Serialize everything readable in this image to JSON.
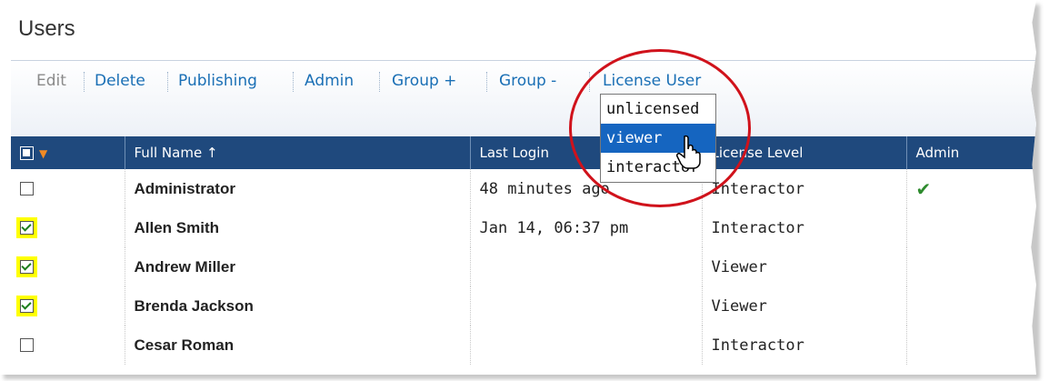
{
  "page": {
    "title": "Users"
  },
  "toolbar": {
    "items": [
      {
        "label": "Edit",
        "enabled": false
      },
      {
        "label": "Delete",
        "enabled": true
      },
      {
        "label": "Publishing",
        "enabled": true
      },
      {
        "label": "Admin",
        "enabled": true
      },
      {
        "label": "Group +",
        "enabled": true
      },
      {
        "label": "Group -",
        "enabled": true
      },
      {
        "label": "License User",
        "enabled": true
      }
    ]
  },
  "dropdown": {
    "options": [
      "unlicensed",
      "viewer",
      "interactor"
    ],
    "selected": "viewer"
  },
  "table": {
    "columns": [
      "",
      "Full Name ↑",
      "Last Login",
      "License Level",
      "Admin"
    ],
    "rows": [
      {
        "name": "Administrator",
        "last_login": "48 minutes ago",
        "license": "Interactor",
        "admin": true,
        "checked": false
      },
      {
        "name": "Allen Smith",
        "last_login": "Jan 14, 06:37 pm",
        "license": "Interactor",
        "admin": false,
        "checked": true
      },
      {
        "name": "Andrew Miller",
        "last_login": "",
        "license": "Viewer",
        "admin": false,
        "checked": true
      },
      {
        "name": "Brenda Jackson",
        "last_login": "",
        "license": "Viewer",
        "admin": false,
        "checked": true
      },
      {
        "name": "Cesar Roman",
        "last_login": "",
        "license": "Interactor",
        "admin": false,
        "checked": false
      }
    ]
  },
  "colors": {
    "header_bg": "#1f497d",
    "link": "#1a6fb5",
    "highlight": "#ffff00",
    "annotation": "#d0121b",
    "selected_option": "#1565c0"
  }
}
